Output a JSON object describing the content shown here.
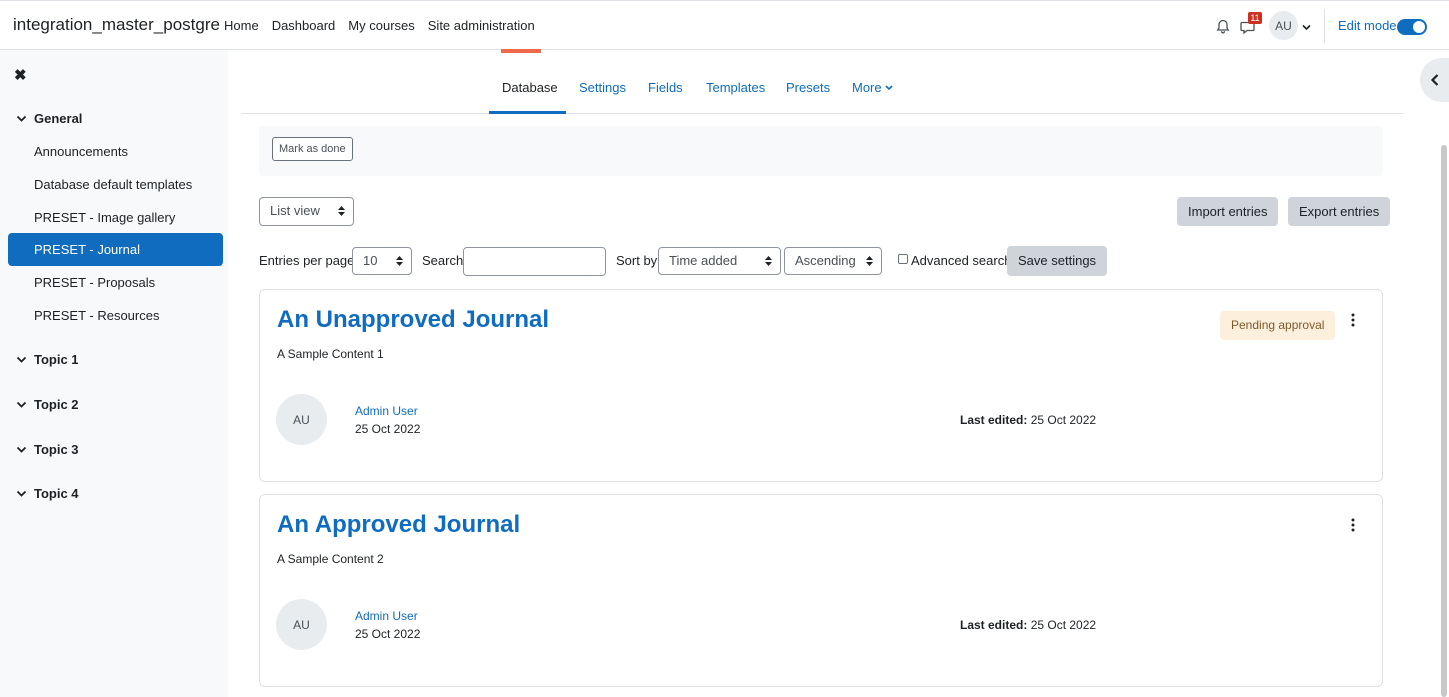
{
  "navbar": {
    "brand": "integration_master_postgre",
    "links": [
      "Home",
      "Dashboard",
      "My courses",
      "Site administration"
    ],
    "notification_count": "11",
    "avatar_initials": "AU",
    "edit_mode_label": "Edit mode",
    "edit_mode_on": true
  },
  "drawer": {
    "sections": [
      {
        "title": "General",
        "items": [
          "Announcements",
          "Database default templates",
          "PRESET - Image gallery",
          "PRESET - Journal",
          "PRESET - Proposals",
          "PRESET - Resources"
        ],
        "active_item": "PRESET - Journal"
      },
      {
        "title": "Topic 1"
      },
      {
        "title": "Topic 2"
      },
      {
        "title": "Topic 3"
      },
      {
        "title": "Topic 4"
      }
    ]
  },
  "secondary_nav": {
    "tabs": [
      "Database",
      "Settings",
      "Fields",
      "Templates",
      "Presets",
      "More"
    ],
    "active_tab": "Database"
  },
  "completion": {
    "mark_done_label": "Mark as done"
  },
  "toolbar": {
    "view_select": "List view",
    "import_label": "Import entries",
    "export_label": "Export entries",
    "entries_per_page_label": "Entries per page",
    "entries_per_page_value": "10",
    "search_label": "Search",
    "search_value": "",
    "sort_by_label": "Sort by",
    "sort_by_value": "Time added",
    "order_value": "Ascending",
    "advanced_search_label": "Advanced search",
    "advanced_search_checked": false,
    "save_settings_label": "Save settings"
  },
  "entries": [
    {
      "title": "An Unapproved Journal",
      "content": "A Sample Content 1",
      "status": "Pending approval",
      "author_initials": "AU",
      "author": "Admin User",
      "date": "25 Oct 2022",
      "last_edited_label": "Last edited:",
      "last_edited": "25 Oct 2022"
    },
    {
      "title": "An Approved Journal",
      "content": "A Sample Content 2",
      "status": "",
      "author_initials": "AU",
      "author": "Admin User",
      "date": "25 Oct 2022",
      "last_edited_label": "Last edited:",
      "last_edited": "25 Oct 2022"
    }
  ],
  "colors": {
    "brand_blue": "#0f6cbf",
    "badge_red": "#ca3120",
    "pending_bg": "#fcefdc",
    "pending_text": "#7d5a29",
    "drawer_bg": "#f8f9fa"
  }
}
